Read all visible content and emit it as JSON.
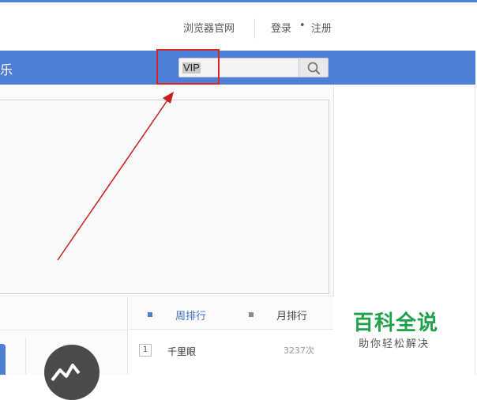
{
  "topbar": {
    "browser_link": "浏览器官网",
    "login": "登录",
    "dot": "•",
    "register": "注册"
  },
  "navbar": {
    "partial_item": "乐"
  },
  "search": {
    "query": "VIP",
    "icon": "search-icon"
  },
  "ranking": {
    "tabs": [
      {
        "label": "周排行"
      },
      {
        "label": "月排行"
      }
    ],
    "items": [
      {
        "rank": "1",
        "title": "千里眼",
        "count": "3237次"
      }
    ]
  },
  "watermark": {
    "title": "百科全说",
    "subtitle": "助你轻松解决"
  },
  "colors": {
    "nav_blue": "#4f7fd5",
    "highlight_red": "#d72626",
    "watermark_green": "#1fa04a"
  }
}
